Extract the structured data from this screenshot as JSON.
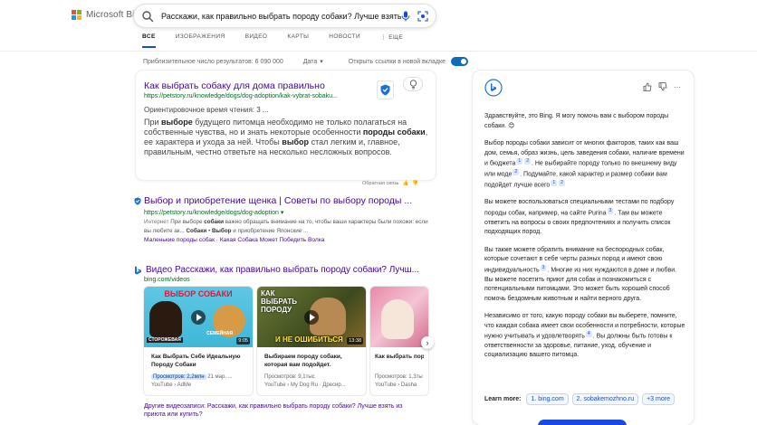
{
  "brand": {
    "logo_text": "Microsoft Bing"
  },
  "search": {
    "query": "Расскажи, как правильно выбрать породу собаки? Лучше взять"
  },
  "tabs": [
    {
      "label": "ВСЕ",
      "active": true
    },
    {
      "label": "ИЗОБРАЖЕНИЯ"
    },
    {
      "label": "ВИДЕО"
    },
    {
      "label": "КАРТЫ"
    },
    {
      "label": "НОВОСТИ"
    },
    {
      "label": "ЕЩЕ"
    }
  ],
  "meta": {
    "results_count": "Приблизительное число результатов: 6 090 000",
    "date_filter": "Дата",
    "open_new_tab": "Открыть ссылки в новой вкладке",
    "new_tab_enabled": true
  },
  "featured": {
    "title": "Как выбрать собаку для дома правильно",
    "url": "https://petstory.ru/knowledge/dogs/dog-adoption/kak-vybrat-sobaku...",
    "reading_time": "Ориентировочное время чтения: 3 ...",
    "body_1": "При ",
    "body_b1": "выборе",
    "body_2": " будущего питомца необходимо не только полагаться на собственные чувства, но и знать некоторые особенности ",
    "body_b2": "породы собаки",
    "body_3": ", ее характера и ухода за ней. Чтобы ",
    "body_b3": "выбор",
    "body_4": " стал легким и, главное, правильным, честно ответьте на несколько несложных вопросов.",
    "feedback": "Обратная связь"
  },
  "result2": {
    "title": "Выбор и приобретение щенка | Советы по выбору породы ...",
    "url": "https://petstory.ru/knowledge/dogs/dog-adoption",
    "snippet_tag": "Интернет",
    "snippet_1": " При выборе ",
    "snippet_b1": "собаки",
    "snippet_2": " важно обращать внимание на то, чтобы ваши характеры были похожи: если вы любите ак... ",
    "snippet_b2": "Собаки",
    "snippet_3": " • ",
    "snippet_b3": "Выбор",
    "snippet_4": " и приобретение Японские ...",
    "link_1": "Маленькие породы собак",
    "link_sep": " · ",
    "link_2": "Какая Собака Может Победить Волка"
  },
  "videos": {
    "heading": "Видео Расскажи, как правильно выбрать породу собаки? Лучш...",
    "source_url": "bing.com/videos",
    "items": [
      {
        "thumb_title": "ВЫБОР СОБАКИ",
        "thumb_left": "СТОРОЖЕВАЯ",
        "thumb_right": "СЕМЕЙНАЯ",
        "duration": "9:05",
        "title": "Как Выбрать Себе Идеальную Породу Собаки",
        "views": "Просмотров: 2,2млн",
        "date": "21 мар. ...",
        "source": "YouTube › AdMe"
      },
      {
        "thumb_title": "КАК ВЫБРАТЬ ПОРОДУ",
        "thumb_bottom": "И НЕ ОШИБИТЬСЯ",
        "duration": "13:38",
        "title": "Выбираем породу собаки, которая вам подойдет.",
        "views": "Просмотров: 9,1тыс",
        "date": "",
        "source": "YouTube › My Dog Ru · Дресир..."
      },
      {
        "thumb_title": "",
        "duration": "",
        "title": "Как выбрать породу собаки",
        "views": "Просмотров: 1,3ты",
        "date": "",
        "source": "YouTube › Dasha"
      }
    ],
    "more_text": "Другие видеозаписи: Расскажи, как правильно выбрать породу собаки? Лучше взять из приюта или купить?"
  },
  "chat": {
    "greeting": "Здравствуйте, это Bing. Я могу помочь вам с выбором породы собаки. 😊",
    "p1_a": "Выбор породы собаки зависит от многих факторов, таких как ваш дом, семья, образ жизнь, цель заведения собаки, наличие времени и бюджета",
    "p1_b": ". Не выбирайте породу только по внешнему виду или моде",
    "p1_c": ". Подумайте, какой характер и размер собаки вам подойдет лучше всего",
    "p2_a": "Вы можете воспользоваться специальными тестами по подбору породы собак, например, на сайте Purina",
    "p2_b": ". Там вы можете ответить на вопросы о своих предпочтениях и получить список подходящих пород.",
    "p3_a": "Вы также можете обратить внимание на беспородных собак, которые сочетают в себе черты разных пород и имеют свою индивидуальность",
    "p3_b": ". Многие из них нуждаются в доме и любви. Вы можете посетить приют для собак и познакомиться с потенциальными питомцами. Это может быть хорошей способ помочь бездомным животным и найти верного друга.",
    "p4_a": "Независимо от того, какую породу собаки вы выберете, помните, что каждая собака имеет свои особенности и потребности, которые нужно учитывать и удовлетворять",
    "p4_b": ". Вы должны быть готовы к ответственности за здоровье, питание, уход, обучение и социализацию вашего питомца.",
    "cite_1": "1",
    "cite_2": "2",
    "cite_3": "3",
    "cite_4": "4",
    "learn_more": "Learn more:",
    "source_1": "1. bing.com",
    "source_2": "2. sobakemozhno.ru",
    "source_more": "+3 more"
  },
  "colors": {
    "accent": "#174ae4",
    "link_visited": "#4007a2",
    "url_green": "#006d21",
    "toggle_on": "#0f6cbd"
  }
}
